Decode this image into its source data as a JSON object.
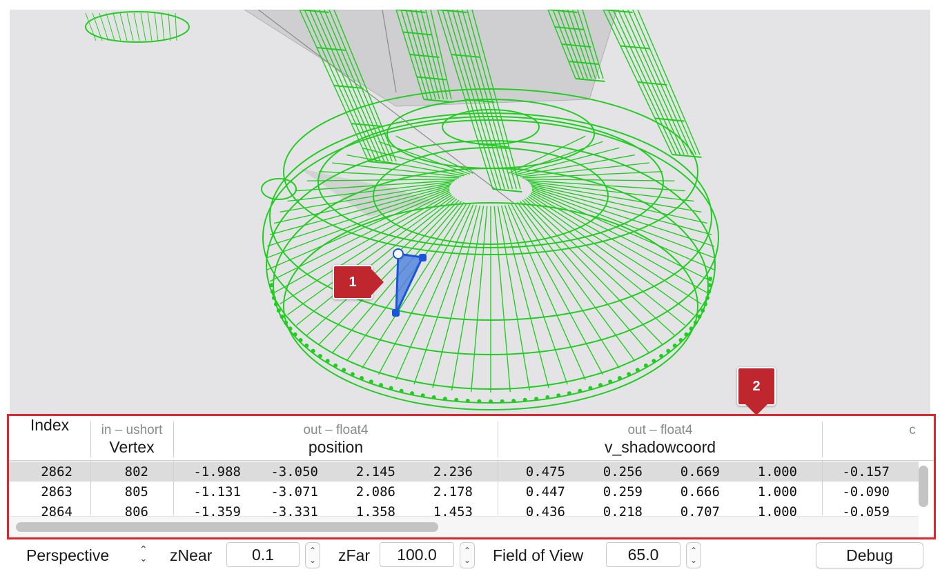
{
  "callouts": {
    "one": "1",
    "two": "2"
  },
  "colors": {
    "wireframe": "#22cc22",
    "selection": "#1a55d8",
    "callout": "#c0262d",
    "highlight_border": "#e0252c"
  },
  "table": {
    "columns": [
      {
        "sub": "",
        "main": "Index"
      },
      {
        "sub": "in – ushort",
        "main": "Vertex"
      },
      {
        "sub": "out – float4",
        "main": "position"
      },
      {
        "sub": "out – float4",
        "main": "v_shadowcoord"
      },
      {
        "sub": "c",
        "main": ""
      }
    ],
    "rows": [
      {
        "index": "2862",
        "vertex": "802",
        "position": [
          "-1.988",
          "-3.050",
          "2.145",
          "2.236"
        ],
        "shadow": [
          "0.475",
          "0.256",
          "0.669",
          "1.000"
        ],
        "extra": "-0.157"
      },
      {
        "index": "2863",
        "vertex": "805",
        "position": [
          "-1.131",
          "-3.071",
          "2.086",
          "2.178"
        ],
        "shadow": [
          "0.447",
          "0.259",
          "0.666",
          "1.000"
        ],
        "extra": "-0.090"
      },
      {
        "index": "2864",
        "vertex": "806",
        "position": [
          "-1.359",
          "-3.331",
          "1.358",
          "1.453"
        ],
        "shadow": [
          "0.436",
          "0.218",
          "0.707",
          "1.000"
        ],
        "extra": "-0.059"
      }
    ]
  },
  "toolbar": {
    "projection": "Perspective",
    "znear_label": "zNear",
    "znear_value": "0.1",
    "zfar_label": "zFar",
    "zfar_value": "100.0",
    "fov_label": "Field of View",
    "fov_value": "65.0",
    "debug_label": "Debug"
  }
}
